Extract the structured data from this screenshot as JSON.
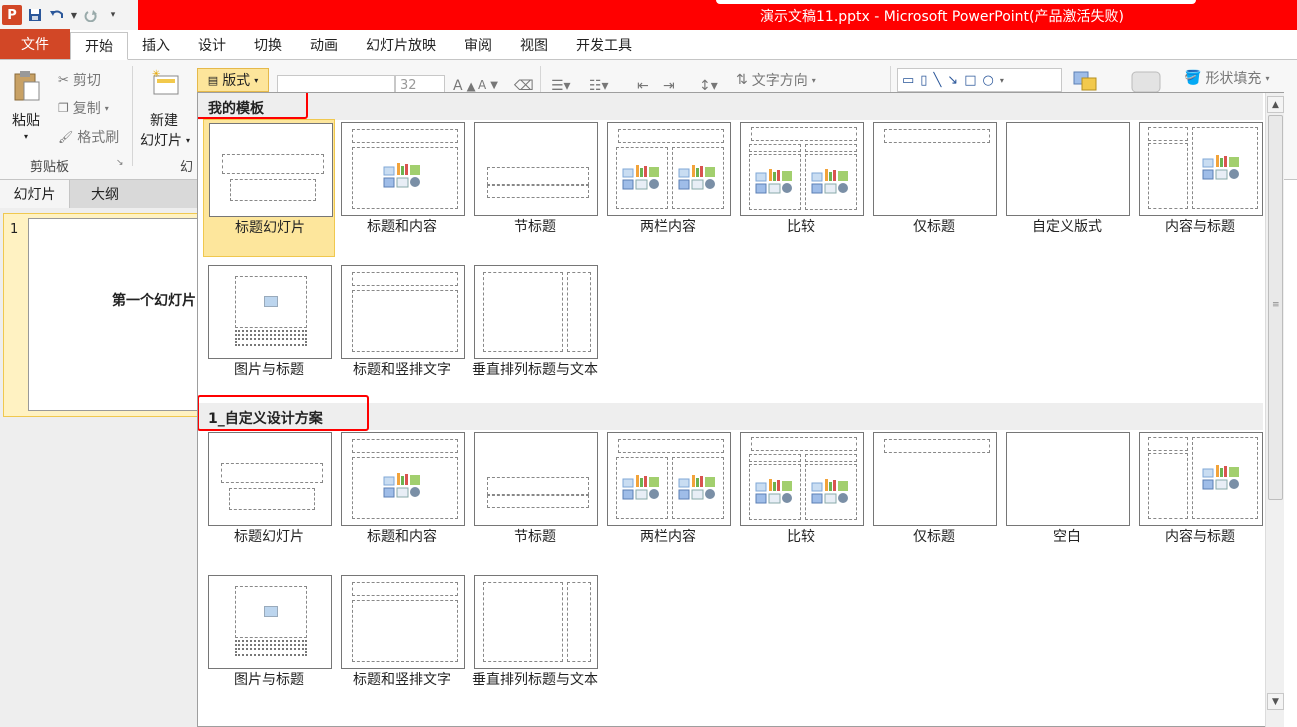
{
  "window": {
    "title": "演示文稿11.pptx - Microsoft PowerPoint(产品激活失败)",
    "app_icon_letter": "P"
  },
  "ribbon_tabs": [
    "文件",
    "开始",
    "插入",
    "设计",
    "切换",
    "动画",
    "幻灯片放映",
    "审阅",
    "视图",
    "开发工具"
  ],
  "ribbon": {
    "paste": "粘贴",
    "cut": "剪切",
    "copy": "复制",
    "format_painter": "格式刷",
    "clipboard_group": "剪贴板",
    "new_slide_line1": "新建",
    "new_slide_line2": "幻灯片",
    "slides_group_partial": "幻",
    "layout": "版式",
    "font_size": "32",
    "text_direction": "文字方向",
    "shape_fill": "形状填充"
  },
  "left_pane": {
    "tab_slides": "幻灯片",
    "tab_outline": "大纲",
    "slide_number": "1",
    "slide_title": "第一个幻灯片"
  },
  "gallery": {
    "sections": [
      {
        "title": "我的模板",
        "layouts": [
          {
            "label": "标题幻灯片",
            "kind": "title",
            "selected": true
          },
          {
            "label": "标题和内容",
            "kind": "title-content"
          },
          {
            "label": "节标题",
            "kind": "section"
          },
          {
            "label": "两栏内容",
            "kind": "two-content"
          },
          {
            "label": "比较",
            "kind": "comparison"
          },
          {
            "label": "仅标题",
            "kind": "title-only"
          },
          {
            "label": "自定义版式",
            "kind": "blank"
          },
          {
            "label": "内容与标题",
            "kind": "content-caption"
          },
          {
            "label": "图片与标题",
            "kind": "picture-caption"
          },
          {
            "label": "标题和竖排文字",
            "kind": "vertical-text"
          },
          {
            "label": "垂直排列标题与文本",
            "kind": "vertical-title"
          }
        ]
      },
      {
        "title": "1_自定义设计方案",
        "layouts": [
          {
            "label": "标题幻灯片",
            "kind": "title"
          },
          {
            "label": "标题和内容",
            "kind": "title-content"
          },
          {
            "label": "节标题",
            "kind": "section"
          },
          {
            "label": "两栏内容",
            "kind": "two-content"
          },
          {
            "label": "比较",
            "kind": "comparison"
          },
          {
            "label": "仅标题",
            "kind": "title-only"
          },
          {
            "label": "空白",
            "kind": "blank"
          },
          {
            "label": "内容与标题",
            "kind": "content-caption"
          },
          {
            "label": "图片与标题",
            "kind": "picture-caption"
          },
          {
            "label": "标题和竖排文字",
            "kind": "vertical-text"
          },
          {
            "label": "垂直排列标题与文本",
            "kind": "vertical-title"
          }
        ]
      }
    ]
  },
  "colors": {
    "file_tab": "#d24726",
    "title_bar": "#ff0000",
    "selection": "#fde69c",
    "highlight_box": "#ff0000"
  }
}
